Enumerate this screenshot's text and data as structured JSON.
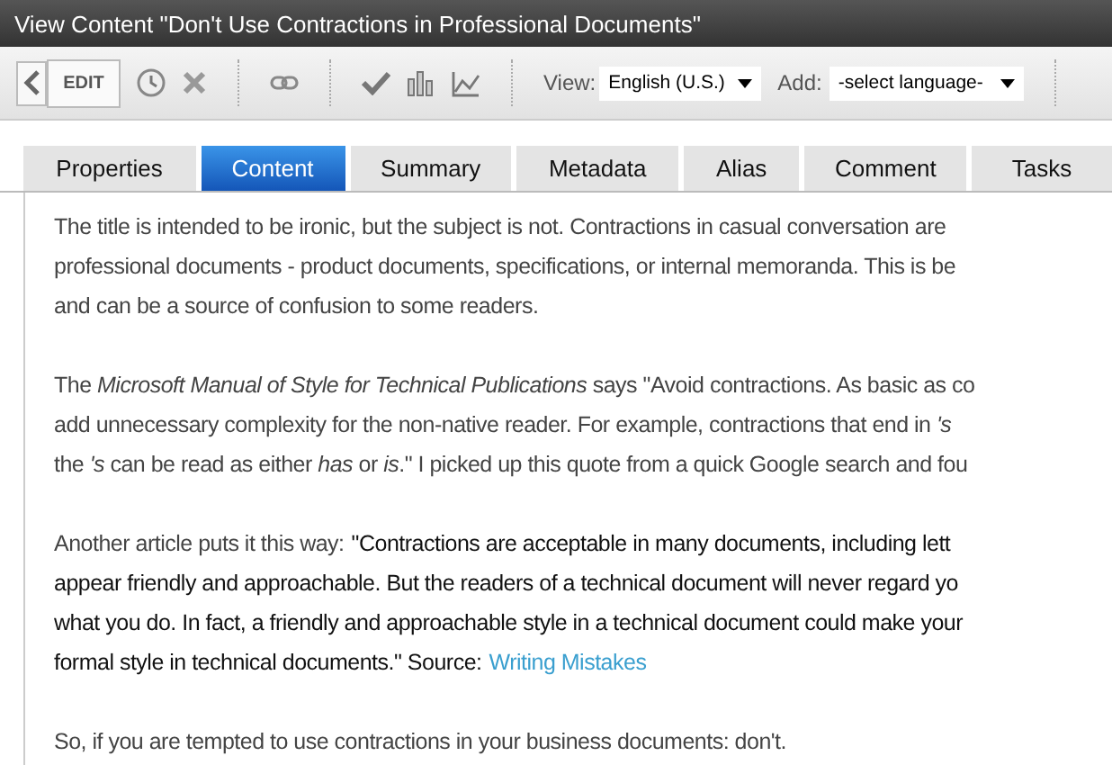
{
  "window": {
    "title": "View Content \"Don't Use Contractions in Professional Documents\""
  },
  "toolbar": {
    "edit_label": "EDIT",
    "view_label": "View:",
    "view_value": "English (U.S.)",
    "add_label": "Add:",
    "add_value": "-select language-"
  },
  "tabs": [
    {
      "label": "Properties",
      "selected": false
    },
    {
      "label": "Content",
      "selected": true
    },
    {
      "label": "Summary",
      "selected": false
    },
    {
      "label": "Metadata",
      "selected": false
    },
    {
      "label": "Alias",
      "selected": false
    },
    {
      "label": "Comment",
      "selected": false
    },
    {
      "label": "Tasks",
      "selected": false
    }
  ],
  "paragraphs": [
    {
      "lines": [
        [
          {
            "kind": "plain",
            "text": "The title is intended to be ironic, but the subject is not. Contractions in casual conversation are"
          }
        ],
        [
          {
            "kind": "plain",
            "text": "professional documents - product documents, specifications, or internal memoranda. This is be"
          }
        ],
        [
          {
            "kind": "plain",
            "text": "and can be a source of confusion to some readers."
          }
        ]
      ]
    },
    {
      "lines": [
        [
          {
            "kind": "plain",
            "text": "The *Microsoft Manual of Style for Technical Publications* says \"Avoid contractions. As basic as co"
          }
        ],
        [
          {
            "kind": "plain",
            "text": "add unnecessary complexity for the non-native reader. For example, contractions that end in *'s*"
          }
        ],
        [
          {
            "kind": "plain",
            "text": "the *'s* can be read as either *has* or *is*.\" I picked up this quote from a quick Google search and fou"
          }
        ]
      ]
    },
    {
      "lines": [
        [
          {
            "kind": "plain",
            "text": "Another article puts it this way:"
          },
          {
            "kind": "quote",
            "text": "\"Contractions are acceptable in many documents, including lett"
          }
        ],
        [
          {
            "kind": "quote",
            "text": "appear friendly and approachable. But the readers of a technical document will never regard yo"
          }
        ],
        [
          {
            "kind": "quote",
            "text": "what you do. In fact, a friendly and approachable style in a technical document could make your"
          }
        ],
        [
          {
            "kind": "quote",
            "text": "formal style in technical documents.\" Source:"
          },
          {
            "kind": "link",
            "text": "Writing Mistakes"
          }
        ]
      ]
    },
    {
      "lines": [
        [
          {
            "kind": "plain",
            "text": "So, if you are tempted to use contractions in your business documents: don't."
          }
        ]
      ]
    }
  ]
}
